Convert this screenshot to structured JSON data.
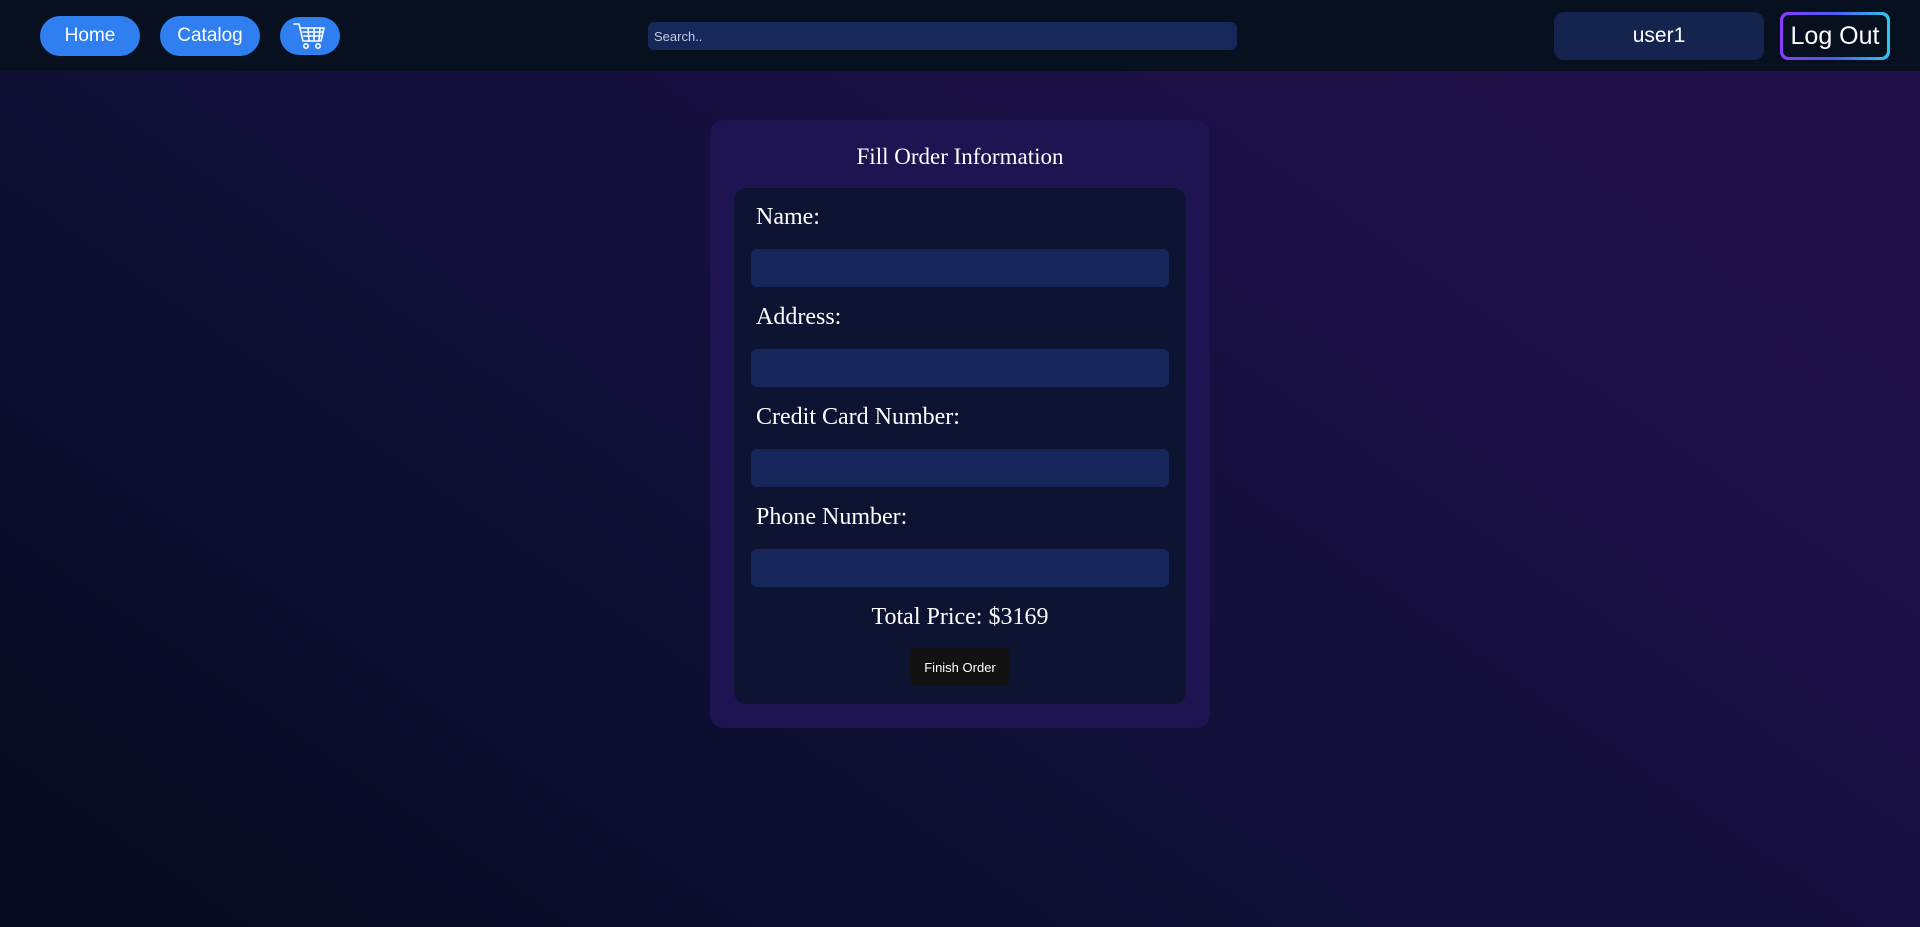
{
  "nav": {
    "home_label": "Home",
    "catalog_label": "Catalog",
    "cart_icon": "shopping-cart-icon",
    "search_placeholder": "Search..",
    "username": "user1",
    "logout_label": "Log Out"
  },
  "order_form": {
    "title": "Fill Order Information",
    "fields": [
      {
        "label": "Name:",
        "value": ""
      },
      {
        "label": "Address:",
        "value": ""
      },
      {
        "label": "Credit Card Number:",
        "value": ""
      },
      {
        "label": "Phone Number:",
        "value": ""
      }
    ],
    "total_price": "Total Price: $3169",
    "finish_label": "Finish Order"
  },
  "colors": {
    "accent_button": "#2f7ff0",
    "navbar": "#06101f",
    "card": "#1f1452",
    "panel": "#0c1431",
    "input": "#17265a"
  }
}
